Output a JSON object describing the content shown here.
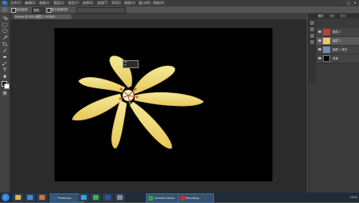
{
  "app": {
    "name": "Adobe Photoshop",
    "logo_text": "Ps"
  },
  "menubar": {
    "items": [
      "文件(F)",
      "编辑(E)",
      "图像(I)",
      "图层(L)",
      "类型(Y)",
      "选择(S)",
      "滤镜(T)",
      "3D(D)",
      "视图(V)",
      "窗口(W)",
      "帮助(H)"
    ]
  },
  "window_controls": {
    "minimize": "–",
    "maximize": "□",
    "close": "×"
  },
  "options_bar": {
    "auto_select_label": "自动选择:",
    "auto_select_value": "图层",
    "show_transform_label": "显示变换控件"
  },
  "document": {
    "tab_label": "Photos @ 50% (图层 2, RGB/8)"
  },
  "tooltip": {
    "line1": "W:",
    "line2": "H:"
  },
  "status": {
    "zoom": "50%",
    "doc_info": "文档:"
  },
  "right_panel": {
    "tabs": [
      "图层",
      "通道",
      "路径"
    ],
    "layers": [
      {
        "name": "图层 2",
        "thumb_color": "#c23b3b",
        "selected": false
      },
      {
        "name": "图层 1",
        "thumb_color": "#e7c86a",
        "selected": true
      },
      {
        "name": "图层 1 拷贝",
        "thumb_color": "#6f8fb0",
        "selected": false
      },
      {
        "name": "背景",
        "thumb_color": "#000000",
        "selected": false
      }
    ]
  },
  "taskbar": {
    "tasks": [
      {
        "label": "Photoshop",
        "color": "#2b5c92"
      },
      {
        "label": "Camtasia Studio",
        "color": "#3a9d4a"
      },
      {
        "label": "Recording...",
        "color": "#b33"
      }
    ],
    "clock": "10:24"
  }
}
